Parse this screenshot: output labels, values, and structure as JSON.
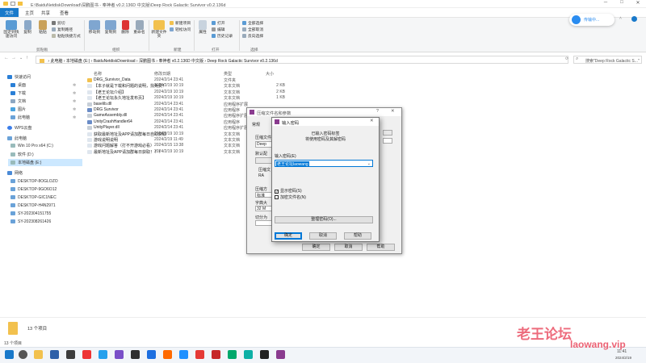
{
  "window": {
    "title": "E:\\BaiduNetdiskDownload\\深鹏图书 - 奉神者 v0.2.136D 中文版\\Deep Rock Galactic Survivor v0.2.136d",
    "controls": [
      "─",
      "□",
      "✕"
    ]
  },
  "menu": {
    "file": "文件",
    "home": "主页",
    "share": "共享",
    "view": "查看"
  },
  "ribbon": {
    "pin_label": "固定到快速访问",
    "copy_label": "复制",
    "paste_label": "粘贴",
    "cut_label": "剪切",
    "copy_path_label": "复制路径",
    "paste_shortcut_label": "粘贴快捷方式",
    "move_to_label": "移动到",
    "copy_to_label": "复制到",
    "delete_label": "删除",
    "rename_label": "重命名",
    "new_folder_label": "新建文件夹",
    "new_item_label": "新建项目",
    "easy_access_label": "轻松访问",
    "properties_label": "属性",
    "open_label": "打开",
    "edit_label": "编辑",
    "history_label": "历史记录",
    "select_all_label": "全部选择",
    "select_none_label": "全部取消",
    "invert_label": "反向选择",
    "group_clipboard": "剪贴板",
    "group_organize": "组织",
    "group_new": "新建",
    "group_open": "打开",
    "group_select": "选择"
  },
  "hint": {
    "label": "传输中..."
  },
  "address": {
    "crumbs": [
      "此电脑",
      "本地磁盘 (E:)",
      "BaiduNetdiskDownload",
      "深鹏图书",
      "奉神者 v0.2.136D 中文版",
      "Deep Rock Galactic Survivor v0.2.136d"
    ],
    "search_placeholder": "搜索\"Deep Rock Galactic S...\""
  },
  "nav": {
    "quick_access": "快速访问",
    "desktop": "桌面",
    "downloads": "下载",
    "documents": "文档",
    "pictures": "图片",
    "this_pc_item": "此电脑",
    "wps_cloud": "WPS云盘",
    "this_pc": "此电脑",
    "drive_c": "Win 10 Pro x64 (C:)",
    "drive_d": "软件 (D:)",
    "drive_e": "本地磁盘 (E:)",
    "network": "网络",
    "computers": [
      "DESKTOP-8OGLOZO",
      "DESKTOP-9GO6O12",
      "DESKTOP-GIC1NEC",
      "DESKTOP-H4N2971",
      "SY-202304151755",
      "SY-202308261426"
    ]
  },
  "files": {
    "headers": {
      "name": "名称",
      "date": "修改日期",
      "type": "类型",
      "size": "大小"
    },
    "rows": [
      {
        "name": "DRG_Survivor_Data",
        "date": "2024/2/14 23:41",
        "type": "文件夹",
        "size": ""
      },
      {
        "name": "【本子就是下载和问题的说明，找免费！",
        "date": "2024/2/19 10:19",
        "type": "文本文档",
        "size": "2 KB"
      },
      {
        "name": "【老王论坛介绍】",
        "date": "2024/2/19 10:19",
        "type": "文本文档",
        "size": "2 KB"
      },
      {
        "name": "【老王论坛永久地址发布页】",
        "date": "2024/2/19 10:19",
        "type": "文本文档",
        "size": "1 KB"
      },
      {
        "name": "baselib.dll",
        "date": "2024/2/14 23:41",
        "type": "应用程序扩展",
        "size": ""
      },
      {
        "name": "DRG Survivor",
        "date": "2024/2/14 23:41",
        "type": "应用程序",
        "size": ""
      },
      {
        "name": "GameAssembly.dll",
        "date": "2024/2/14 23:41",
        "type": "应用程序扩展",
        "size": ""
      },
      {
        "name": "UnityCrashHandler64",
        "date": "2024/2/14 23:41",
        "type": "应用程序",
        "size": ""
      },
      {
        "name": "UnityPlayer.dll",
        "date": "2024/2/14 23:41",
        "type": "应用程序扩展",
        "size": ""
      },
      {
        "name": "获取最新地址及APP请加群每日自助获取",
        "date": "2024/2/19 10:19",
        "type": "文本文档",
        "size": ""
      },
      {
        "name": "游戏说明说明",
        "date": "2024/2/19 11:49",
        "type": "文本文档",
        "size": ""
      },
      {
        "name": "游戏问题解答（打不开游戏必看）",
        "date": "2024/2/15 13:38",
        "type": "文本文档",
        "size": ""
      },
      {
        "name": "最新地址及APP请加群每日获取！！！",
        "date": "2024/2/19 10:19",
        "type": "文本文档",
        "size": ""
      }
    ]
  },
  "details": {
    "count": "13 个项目"
  },
  "status": {
    "count": "13 个项目"
  },
  "prop_dialog": {
    "title": "压缩文件名和参数",
    "tab_general": "常规",
    "label_archive": "压缩文件",
    "archive_value": "Deep",
    "label_default": "默认配",
    "label_format": "压缩文",
    "format_opt": "RA",
    "label_method": "压缩方",
    "method_value": "标准",
    "label_dict": "字典大",
    "dict_value": "32 M",
    "label_split": "切分为",
    "ok": "确定",
    "cancel": "取消",
    "help": "帮助"
  },
  "pw_dialog": {
    "title": "输入密码",
    "heading1": "已输入密码标签",
    "heading2": "将使用密码及其解密码",
    "enter_label": "输入密码(E)",
    "password_value": "老王论坛laowang",
    "show_password": "显示密码(S)",
    "encrypt_names": "加密文件名(N)",
    "organize": "整理密码(O)...",
    "ok": "确定",
    "cancel": "取消",
    "help": "帮助"
  },
  "watermark": {
    "text1": "老王论坛",
    "text2": "laowang.vip"
  },
  "taskbar": {
    "time": "11:41",
    "date": "2024/2/19"
  }
}
